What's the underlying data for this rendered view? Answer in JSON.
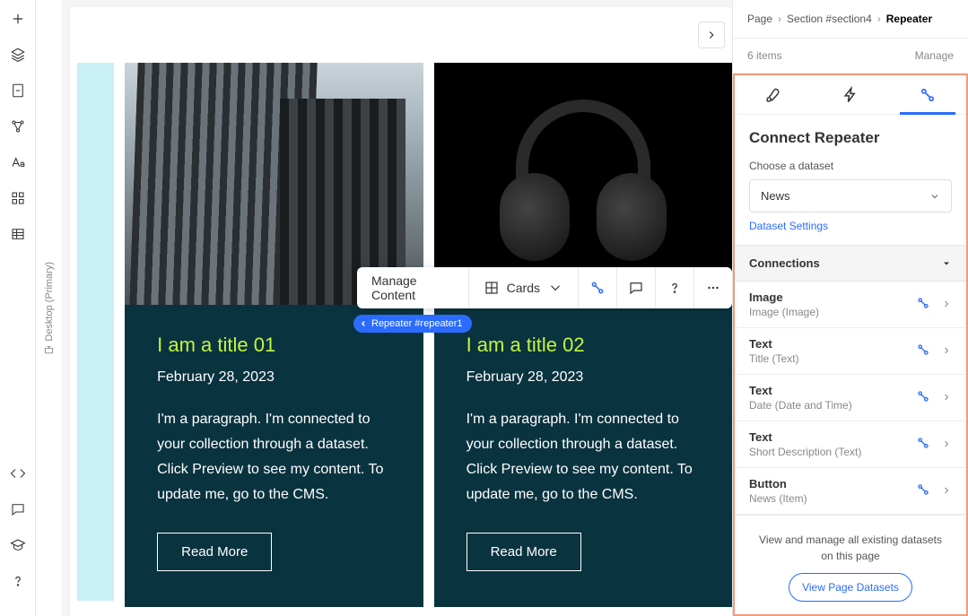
{
  "breadcrumb": {
    "page": "Page",
    "section": "Section #section4",
    "current": "Repeater"
  },
  "items_row": {
    "count": "6 items",
    "manage": "Manage"
  },
  "panel": {
    "title": "Connect Repeater",
    "choose_label": "Choose a dataset",
    "dataset": "News",
    "dataset_settings": "Dataset Settings",
    "connections_header": "Connections",
    "connections": [
      {
        "name": "Image",
        "sub": "Image (Image)"
      },
      {
        "name": "Text",
        "sub": "Title (Text)"
      },
      {
        "name": "Text",
        "sub": "Date (Date and Time)"
      },
      {
        "name": "Text",
        "sub": "Short Description (Text)"
      },
      {
        "name": "Button",
        "sub": "News (Item)"
      }
    ],
    "footer_note": "View and manage all existing datasets on this page",
    "view_datasets": "View Page Datasets"
  },
  "toolbar": {
    "manage": "Manage Content",
    "cards": "Cards"
  },
  "badge": "Repeater #repeater1",
  "gutter": "Desktop (Primary)",
  "cards": [
    {
      "title": "I am a title 01",
      "date": "February 28, 2023",
      "desc": "I'm a paragraph. I'm connected to your collection through a dataset. Click Preview to see my content. To update me, go to the CMS.",
      "button": "Read More"
    },
    {
      "title": "I am a title 02",
      "date": "February 28, 2023",
      "desc": "I'm a paragraph. I'm connected to your collection through a dataset. Click Preview to see my content. To update me, go to the CMS.",
      "button": "Read More"
    }
  ]
}
